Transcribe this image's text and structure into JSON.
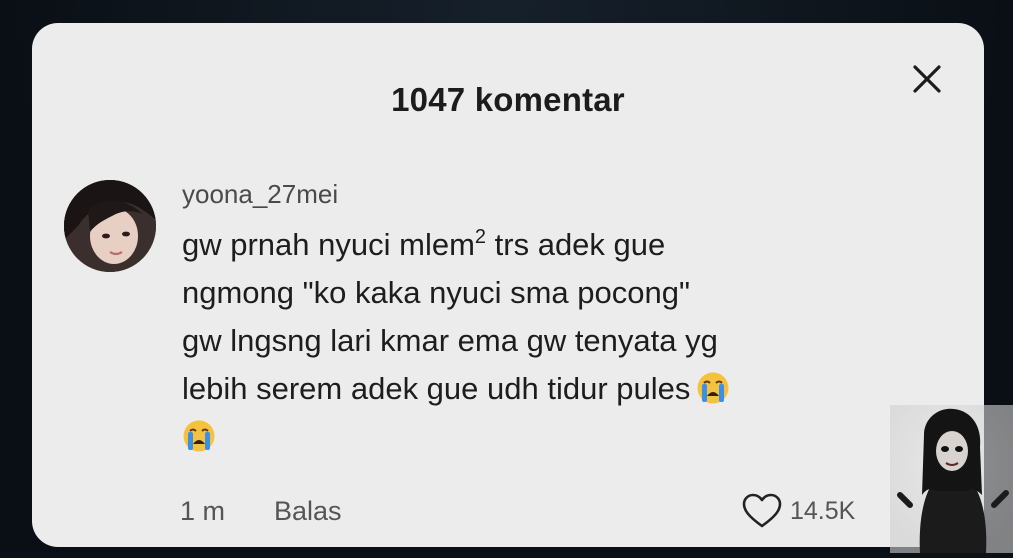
{
  "header": {
    "title": "1047 komentar",
    "close_icon": "close-icon"
  },
  "comment": {
    "username": "yoona_27mei",
    "text_lines": [
      "gw prnah nyuci mlem",
      "trs adek gue",
      "ngmong \"ko kaka nyuci sma pocong\"",
      "gw lngsng lari kmar ema gw tenyata yg",
      "lebih serem adek gue udh tidur pules"
    ],
    "superscript": "2",
    "emoji": "loudly-crying-face",
    "time": "1 m",
    "reply_label": "Balas",
    "likes": "14.5K",
    "like_icon": "heart-outline-icon"
  },
  "colors": {
    "card_bg": "#ececec",
    "outer_bg": "#0b1118",
    "text": "#1d1d1d",
    "muted": "#555555"
  }
}
